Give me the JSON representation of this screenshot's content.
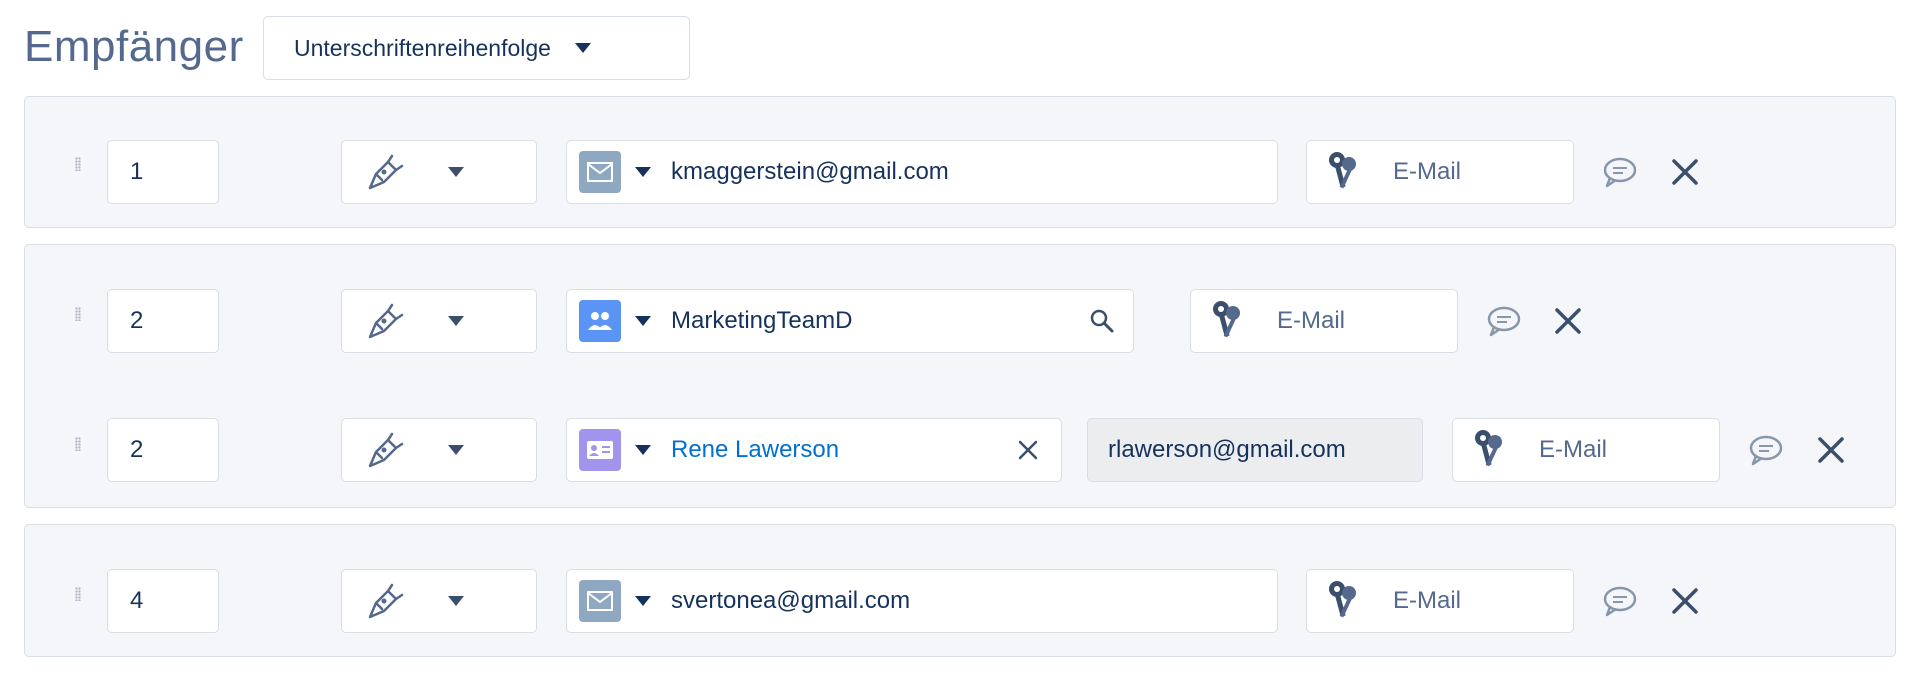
{
  "header": {
    "title": "Empfänger",
    "order_select": "Unterschriftenreihenfolge"
  },
  "recipients": [
    {
      "order": "1",
      "type": "email",
      "value": "kmaggerstein@gmail.com",
      "auth": "E-Mail"
    },
    {
      "order": "2",
      "type": "group",
      "value": "MarketingTeamD",
      "auth": "E-Mail"
    },
    {
      "order": "2",
      "type": "contact",
      "value": "Rene Lawerson",
      "email": "rlawerson@gmail.com",
      "auth": "E-Mail"
    },
    {
      "order": "4",
      "type": "email",
      "value": "svertonea@gmail.com",
      "auth": "E-Mail"
    }
  ],
  "icons": {
    "drag": "drag-handle-icon",
    "action": "pen-nib-icon",
    "email": "envelope-icon",
    "group": "people-group-icon",
    "contact": "contact-card-icon",
    "auth": "keys-icon",
    "note": "speech-bubble-icon",
    "remove": "close-icon",
    "search": "search-icon"
  },
  "colors": {
    "row_bg": "#f4f6f9",
    "border": "#d8dde6",
    "link": "#0070d2",
    "email_avatar": "#8fa8c2",
    "group_avatar": "#5a95f5",
    "contact_avatar": "#a094ed"
  }
}
